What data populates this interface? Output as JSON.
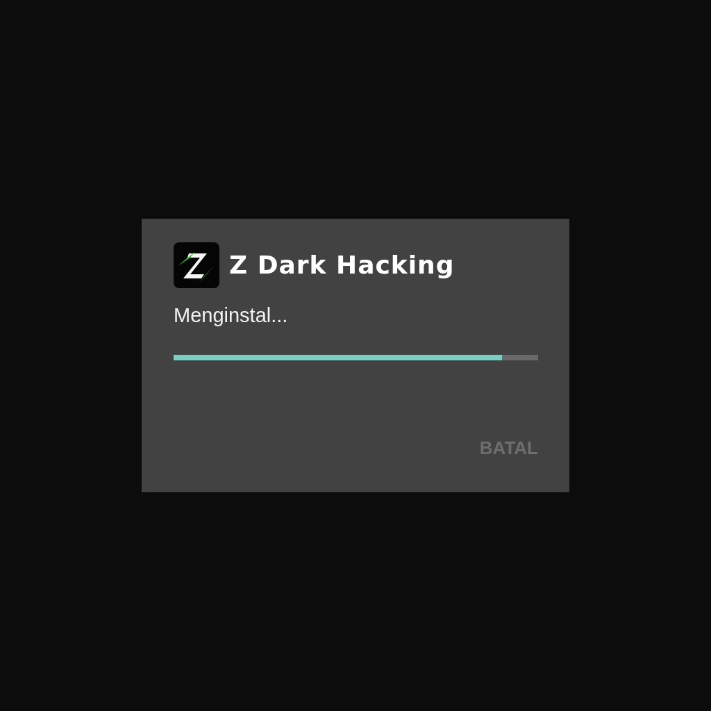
{
  "dialog": {
    "title": "Z Dark Hacking",
    "message": "Menginstal...",
    "progress": {
      "level": 0.9
    },
    "cancel_button": {
      "label": "BATAL",
      "disabled": true
    }
  }
}
